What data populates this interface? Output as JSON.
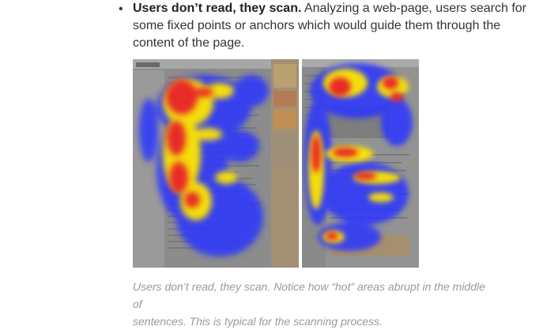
{
  "bullet": {
    "bold_lead": "Users don’t read, they scan.",
    "text": " Analyzing a web-page, users search for some fixed points or anchors which would guide them through the content of the page."
  },
  "figure": {
    "alt": "Eye-tracking heatmaps of two web pages showing F-shaped scanning patterns"
  },
  "caption": {
    "line1": "Users don’t read, they scan. Notice how “hot” areas abrupt in the middle of",
    "line2": "sentences. This is typical for the scanning process."
  },
  "colors": {
    "text": "#333333",
    "caption": "#9a9a9a",
    "heat_hot": "#e8202a",
    "heat_warm": "#ffe600",
    "heat_cool": "#2a35ff"
  }
}
